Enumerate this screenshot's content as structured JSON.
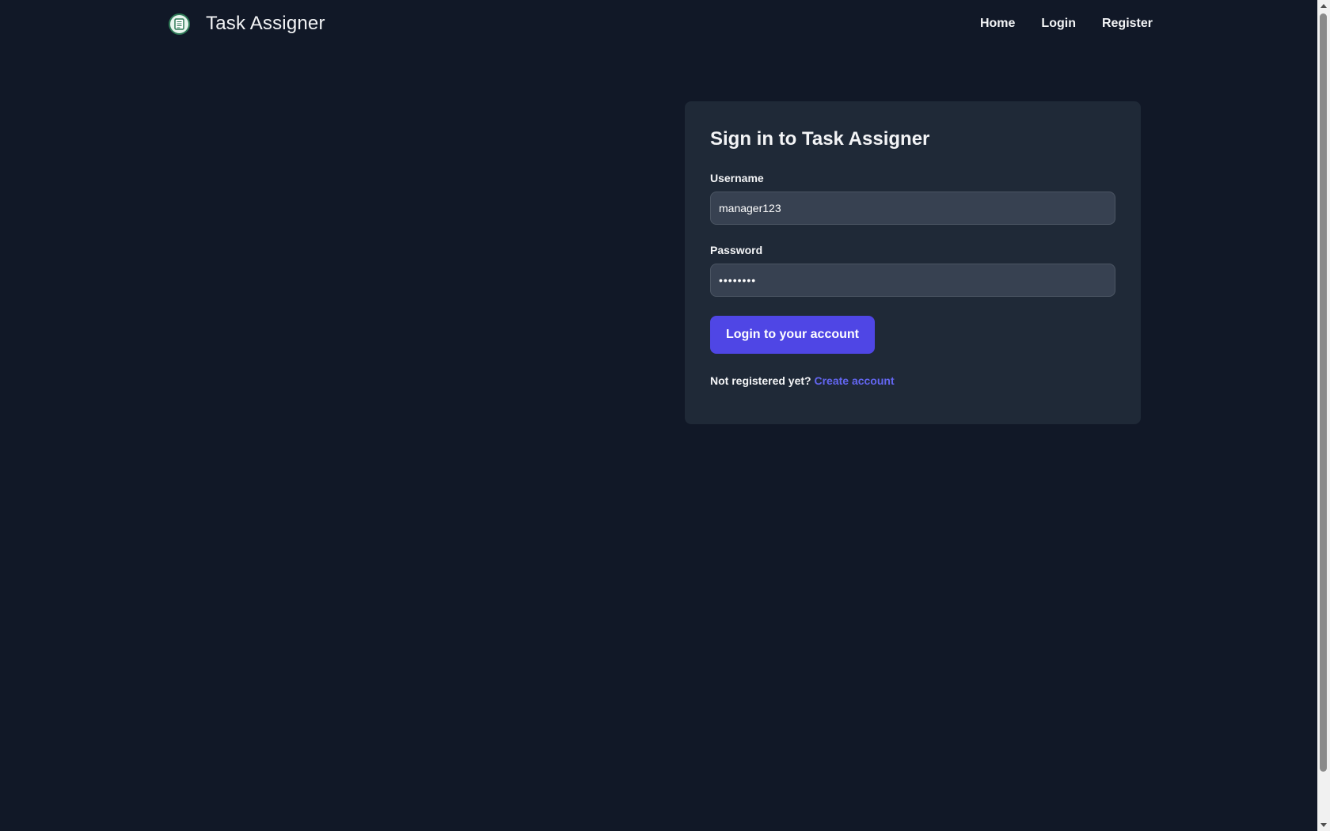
{
  "brand": {
    "name": "Task Assigner"
  },
  "nav": {
    "items": [
      {
        "label": "Home"
      },
      {
        "label": "Login"
      },
      {
        "label": "Register"
      }
    ]
  },
  "login": {
    "title": "Sign in to Task Assigner",
    "username_label": "Username",
    "username_value": "manager123",
    "password_label": "Password",
    "password_value": "••••••••",
    "submit_label": "Login to your account",
    "register_prompt": "Not registered yet?",
    "register_link": "Create account"
  },
  "colors": {
    "background": "#111827",
    "card": "#1f2937",
    "input": "#374151",
    "accent": "#4f46e5",
    "link": "#6366f1"
  }
}
